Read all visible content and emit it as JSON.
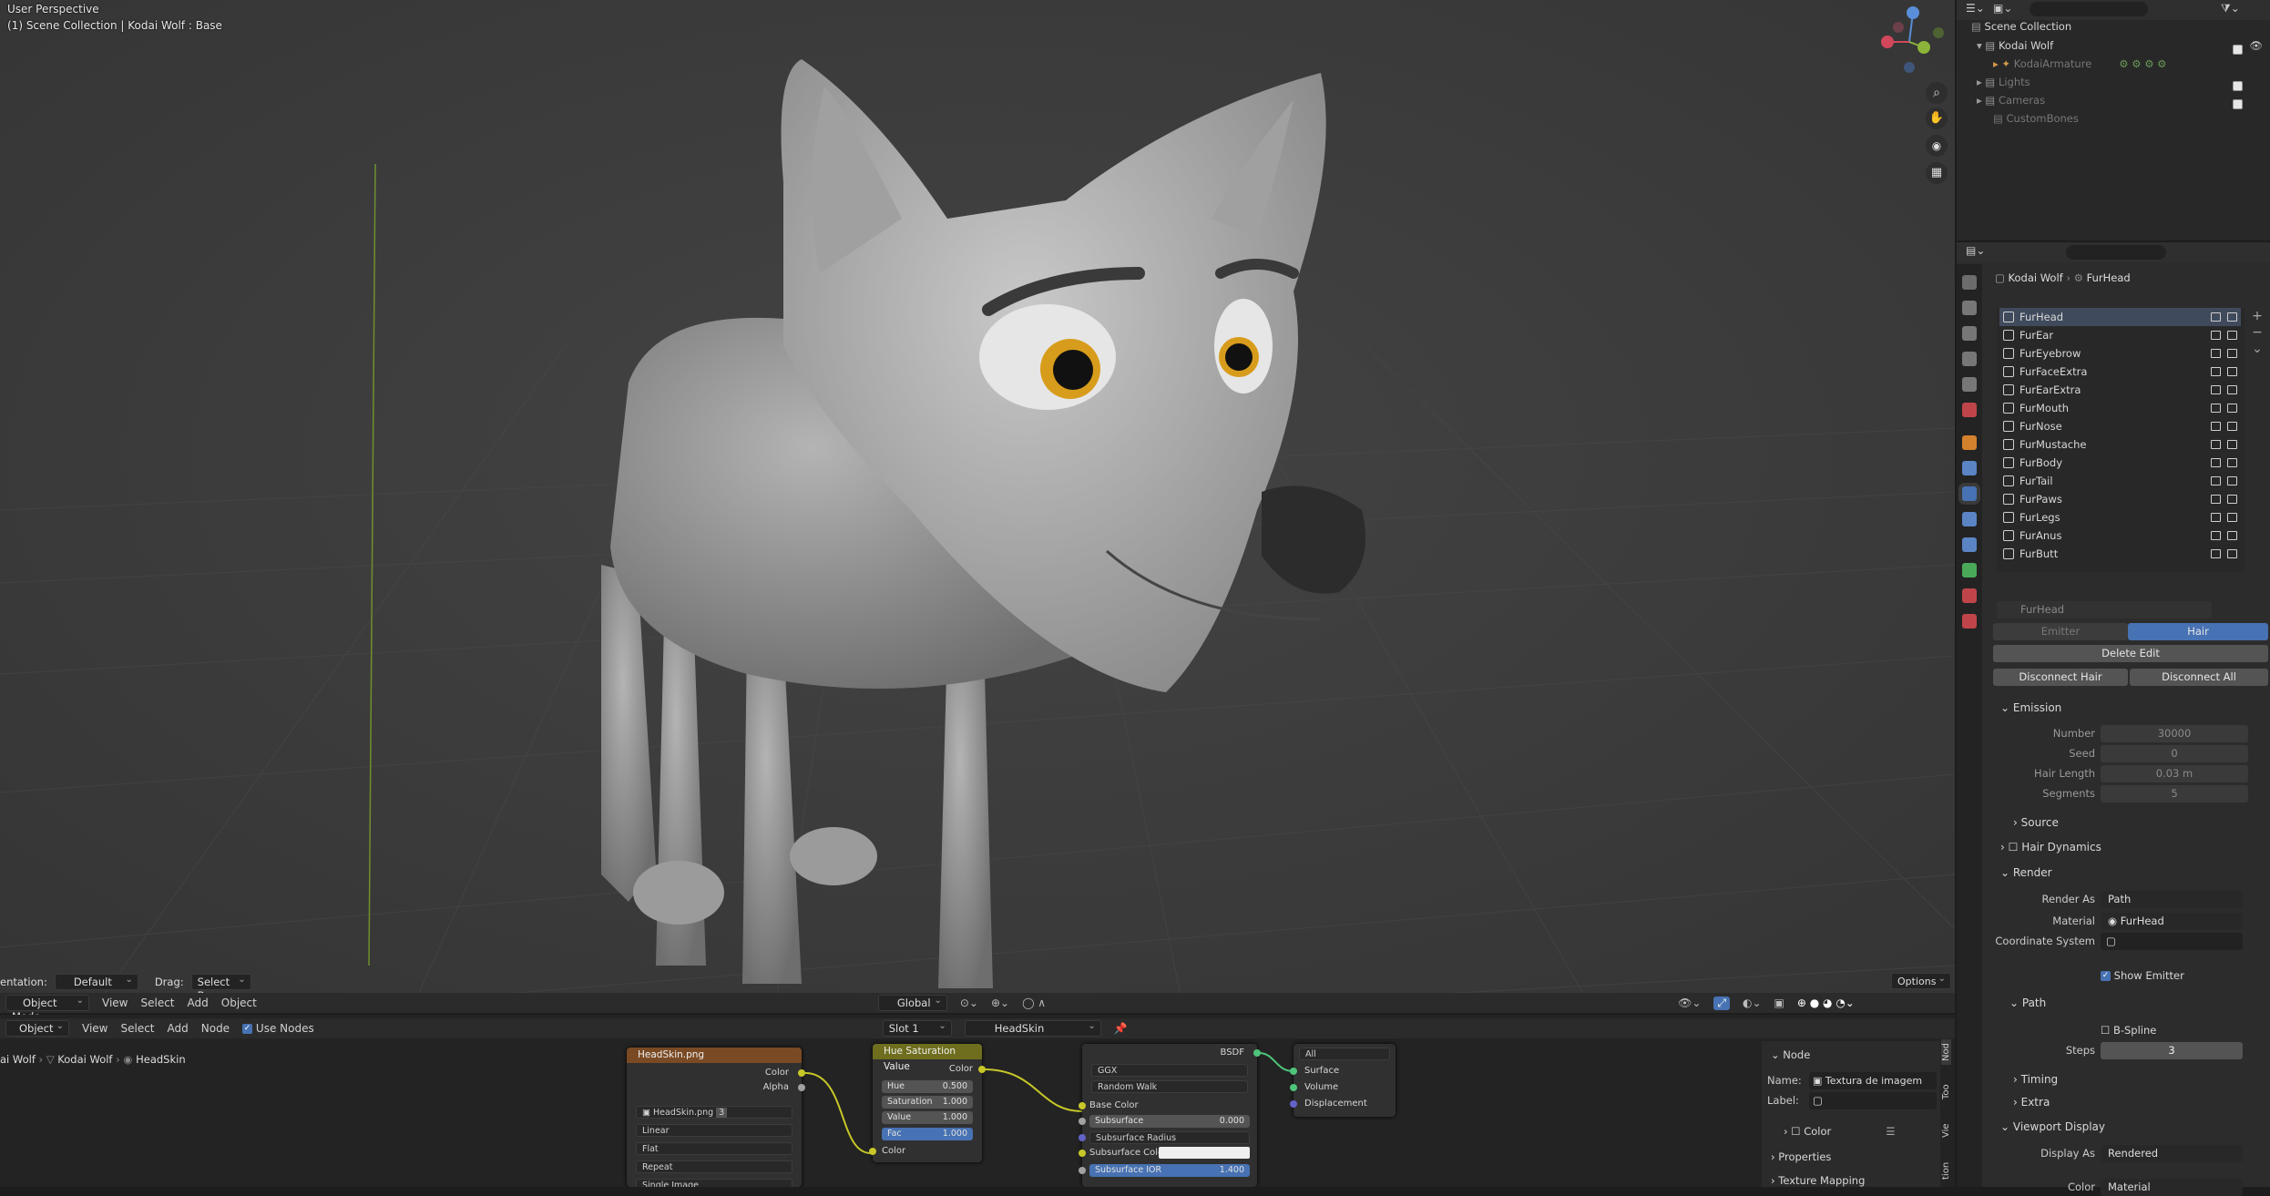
{
  "viewport": {
    "perspective": "User Perspective",
    "collection": "(1) Scene Collection | Kodai Wolf : Base",
    "orientation_label": "entation:",
    "orientation_value": "Default",
    "drag_label": "Drag:",
    "drag_value": "Select Box",
    "options": "Options",
    "mode": "Object Mode",
    "menus": [
      "View",
      "Select",
      "Add",
      "Object"
    ],
    "transform": "Global"
  },
  "outliner": {
    "scene_collection": "Scene Collection",
    "items": [
      "Kodai Wolf",
      "KodaiArmature",
      "Lights",
      "Cameras",
      "CustomBones"
    ]
  },
  "properties": {
    "breadcrumb_object": "Kodai Wolf",
    "breadcrumb_system": "FurHead",
    "systems": [
      "FurHead",
      "FurEar",
      "FurEyebrow",
      "FurFaceExtra",
      "FurEarExtra",
      "FurMouth",
      "FurNose",
      "FurMustache",
      "FurBody",
      "FurTail",
      "FurPaws",
      "FurLegs",
      "FurAnus",
      "FurButt"
    ],
    "settings_name": "FurHead",
    "type_emitter": "Emitter",
    "type_hair": "Hair",
    "delete_edit": "Delete Edit",
    "disconnect_hair": "Disconnect Hair",
    "disconnect_all": "Disconnect All",
    "emission": "Emission",
    "number_label": "Number",
    "number_value": "30000",
    "seed_label": "Seed",
    "seed_value": "0",
    "hair_length_label": "Hair Length",
    "hair_length_value": "0.03 m",
    "segments_label": "Segments",
    "segments_value": "5",
    "source": "Source",
    "hair_dynamics": "Hair Dynamics",
    "render": "Render",
    "render_as_label": "Render As",
    "render_as_value": "Path",
    "material_label": "Material",
    "material_value": "FurHead",
    "coord_label": "Coordinate System",
    "show_emitter": "Show Emitter",
    "path": "Path",
    "bspline": "B-Spline",
    "steps_label": "Steps",
    "steps_value": "3",
    "timing": "Timing",
    "extra": "Extra",
    "viewport_display": "Viewport Display",
    "display_as_label": "Display As",
    "display_as_value": "Rendered",
    "color_label": "Color",
    "color_value": "Material"
  },
  "node_editor": {
    "object": "Object",
    "menus": [
      "View",
      "Select",
      "Add",
      "Node"
    ],
    "use_nodes": "Use Nodes",
    "slot": "Slot 1",
    "material": "HeadSkin",
    "breadcrumb": [
      "ai Wolf",
      "Kodai Wolf",
      "HeadSkin"
    ],
    "image_node": {
      "title": "HeadSkin.png",
      "out_color": "Color",
      "out_alpha": "Alpha",
      "image": "HeadSkin.png",
      "users": "3",
      "interp": "Linear",
      "proj": "Flat",
      "ext": "Repeat",
      "source": "Single Image"
    },
    "hsv_node": {
      "title": "Hue Saturation Value",
      "out": "Color",
      "hue": "Hue",
      "hue_v": "0.500",
      "sat": "Saturation",
      "sat_v": "1.000",
      "val": "Value",
      "val_v": "1.000",
      "fac": "Fac",
      "fac_v": "1.000",
      "in_color": "Color"
    },
    "bsdf_node": {
      "title": "BSDF",
      "ggx": "GGX",
      "rw": "Random Walk",
      "base": "Base Color",
      "subsurface": "Subsurface",
      "subsurface_v": "0.000",
      "ss_radius": "Subsurface Radius",
      "ss_color": "Subsurface Color",
      "ss_ior": "Subsurface IOR",
      "ss_ior_v": "1.400"
    },
    "output_node": {
      "target": "All",
      "surface": "Surface",
      "volume": "Volume",
      "disp": "Displacement"
    },
    "sidebar": {
      "node": "Node",
      "name_label": "Name:",
      "name_value": "Textura de imagem",
      "label_label": "Label:",
      "color": "Color",
      "props": "Properties",
      "tex_map": "Texture Mapping",
      "tabs": [
        "Nod",
        "Too",
        "Vie",
        "tion"
      ]
    }
  }
}
